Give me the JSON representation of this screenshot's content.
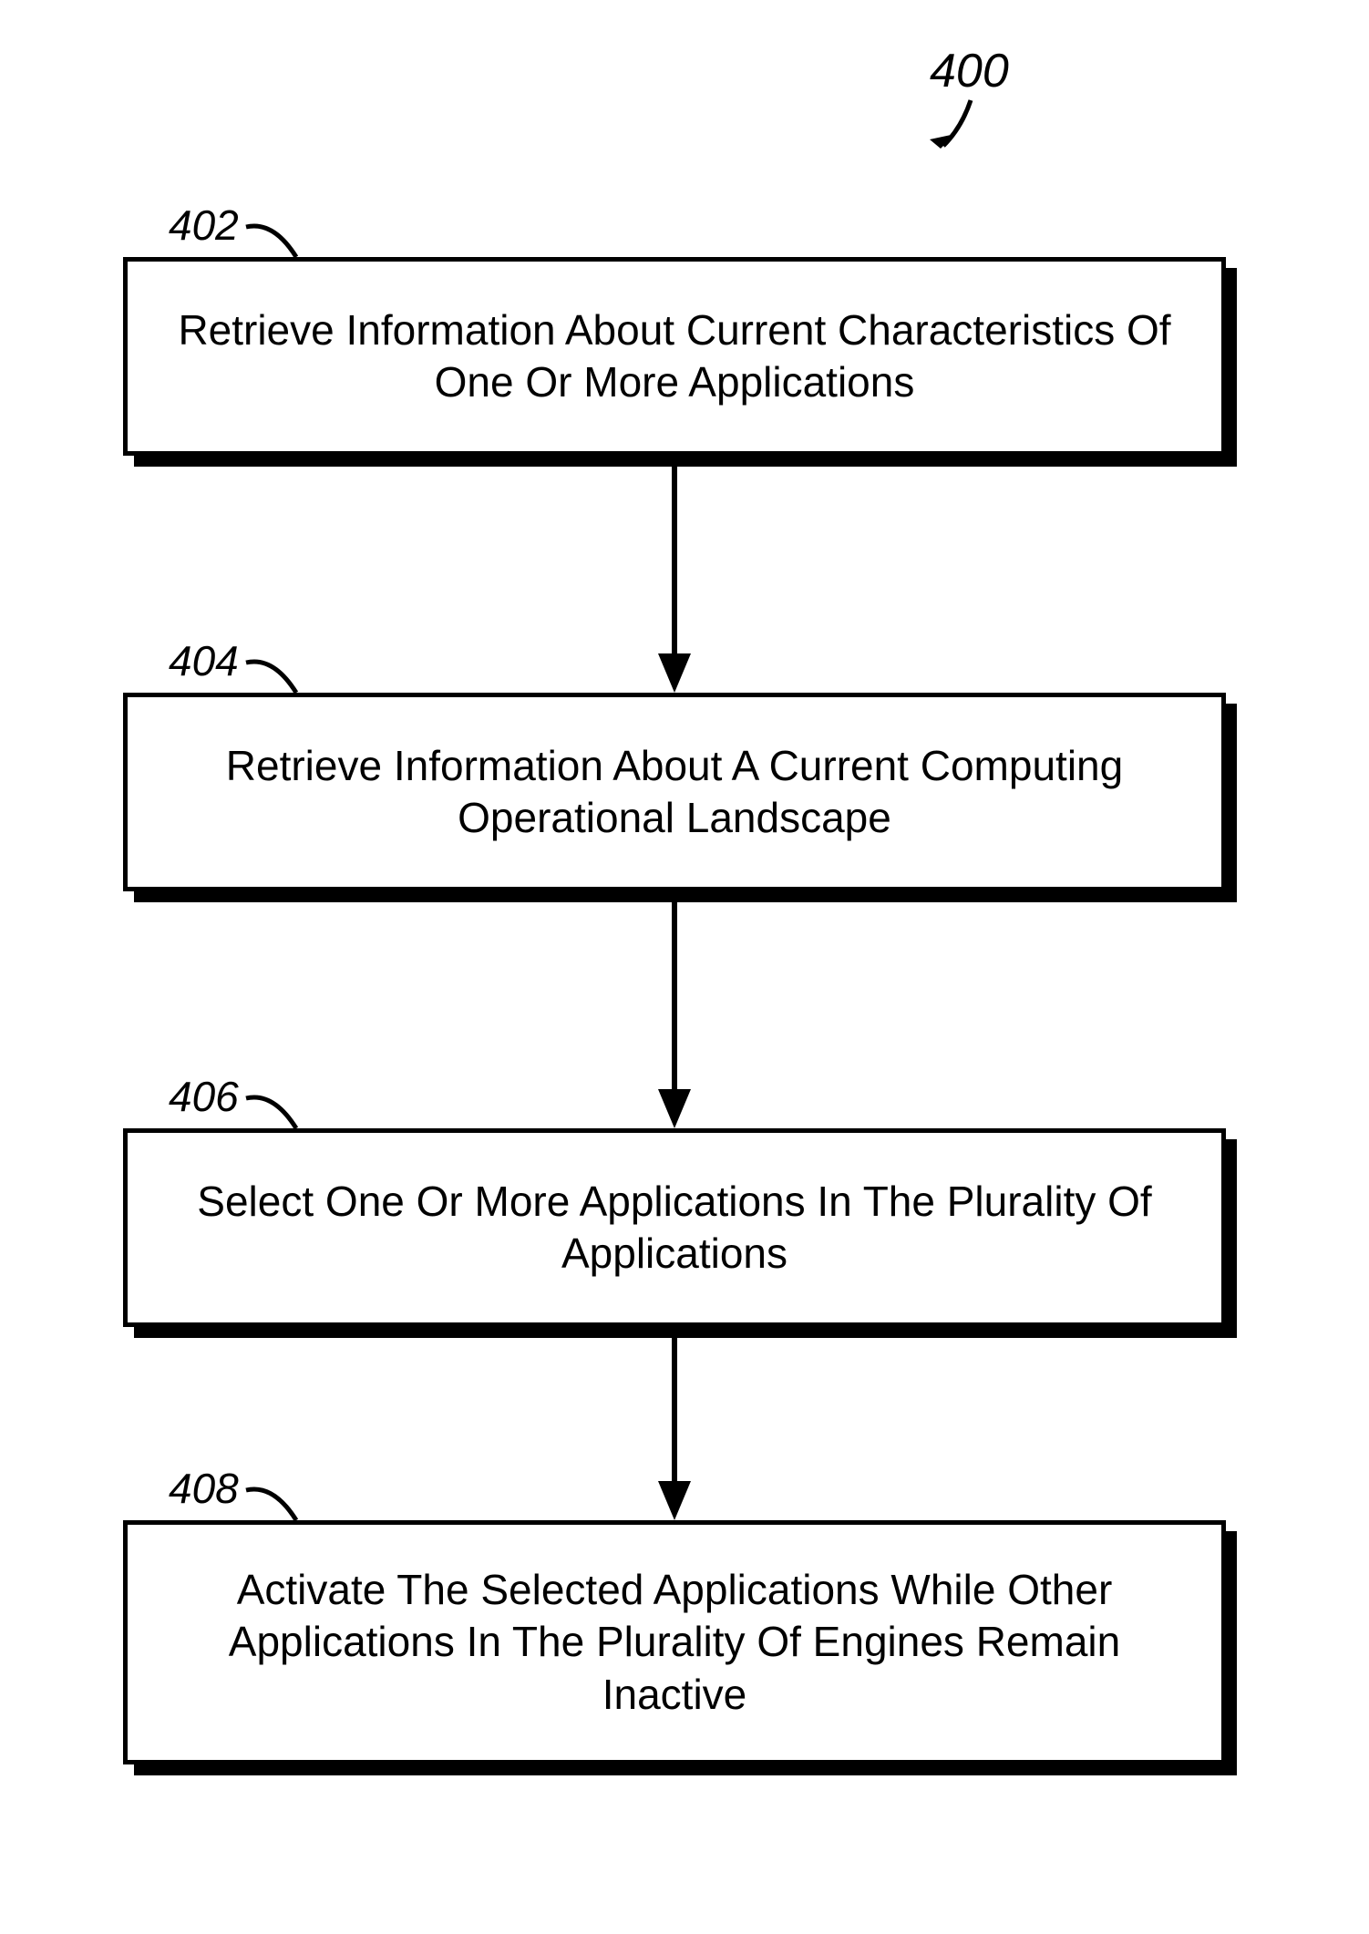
{
  "figure": {
    "number": "400"
  },
  "steps": [
    {
      "label": "402",
      "text": "Retrieve Information About Current Characteristics Of One Or More Applications"
    },
    {
      "label": "404",
      "text": "Retrieve Information About A Current Computing Operational Landscape"
    },
    {
      "label": "406",
      "text": "Select One Or More Applications In The Plurality Of Applications"
    },
    {
      "label": "408",
      "text": "Activate The Selected Applications While Other Applications In The Plurality Of Engines Remain Inactive"
    }
  ]
}
